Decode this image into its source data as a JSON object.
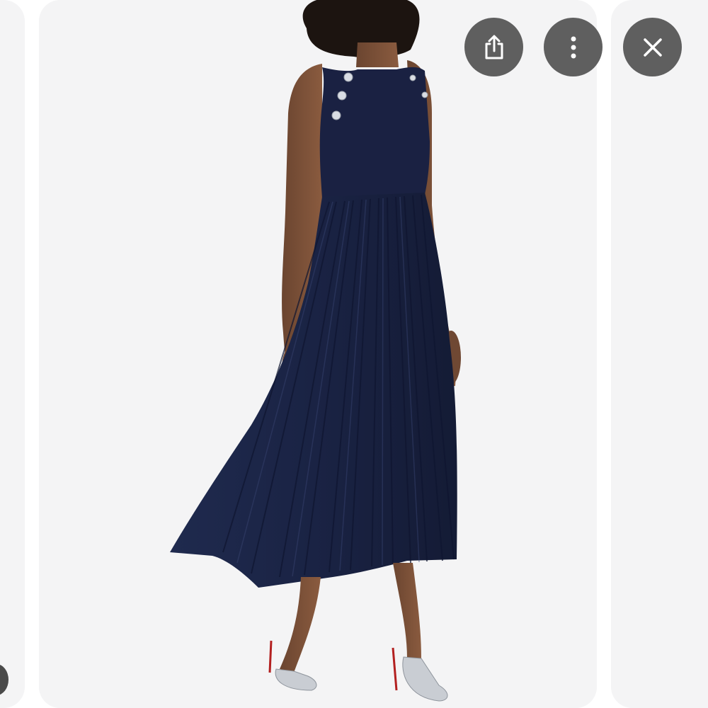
{
  "viewer": {
    "image_subject": "model-in-navy-pleated-halter-midi-dress",
    "colors": {
      "card_background": "#f4f4f5",
      "button_background": "#5f5f5f",
      "button_icon": "#ffffff",
      "dress": "#1b2340"
    }
  },
  "actions": [
    {
      "id": "share",
      "icon": "share-icon"
    },
    {
      "id": "more",
      "icon": "more-vertical-icon"
    },
    {
      "id": "close",
      "icon": "close-icon"
    }
  ]
}
